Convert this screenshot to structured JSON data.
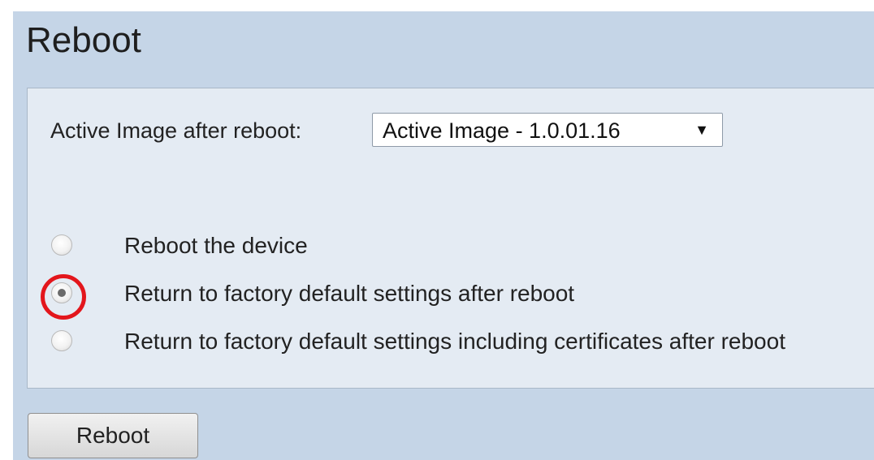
{
  "page": {
    "title": "Reboot"
  },
  "form": {
    "active_image_label": "Active Image after reboot:",
    "active_image_select": {
      "selected": "Active Image - 1.0.01.16",
      "arrow_icon": "dropdown-arrow-icon"
    },
    "options": [
      {
        "label": "Reboot the device",
        "checked": false
      },
      {
        "label": "Return to factory default settings after reboot",
        "checked": true,
        "highlighted": true
      },
      {
        "label": "Return to factory default settings including certificates after reboot",
        "checked": false
      }
    ]
  },
  "actions": {
    "reboot_label": "Reboot"
  },
  "colors": {
    "page_background": "#c5d5e7",
    "panel_background": "#e4ebf3",
    "highlight_ring": "#e3161c"
  }
}
